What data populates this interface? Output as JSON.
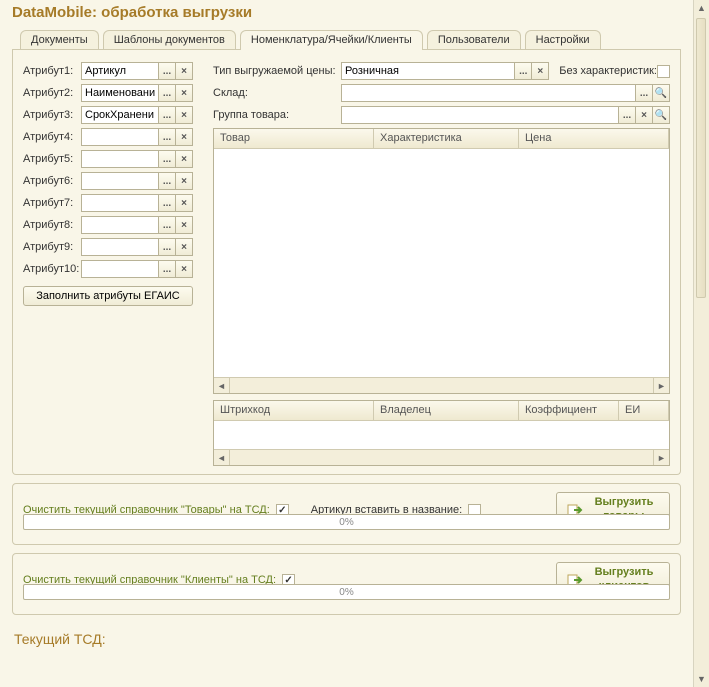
{
  "title": "DataMobile: обработка выгрузки",
  "tabs": [
    "Документы",
    "Шаблоны документов",
    "Номенклатура/Ячейки/Клиенты",
    "Пользователи",
    "Настройки"
  ],
  "active_tab": 2,
  "attributes": {
    "labels": [
      "Атрибут1:",
      "Атрибут2:",
      "Атрибут3:",
      "Атрибут4:",
      "Атрибут5:",
      "Атрибут6:",
      "Атрибут7:",
      "Атрибут8:",
      "Атрибут9:",
      "Атрибут10:"
    ],
    "values": [
      "Артикул",
      "Наименовани",
      "СрокХранени",
      "",
      "",
      "",
      "",
      "",
      "",
      ""
    ],
    "fill_btn": "Заполнить атрибуты ЕГАИС"
  },
  "top_fields": {
    "price_type_label": "Тип выгружаемой цены:",
    "price_type_value": "Розничная",
    "no_char_label": "Без характеристик:",
    "no_char_checked": false,
    "warehouse_label": "Склад:",
    "warehouse_value": "",
    "group_label": "Группа товара:",
    "group_value": ""
  },
  "grid1": {
    "cols": [
      "Товар",
      "Характеристика",
      "Цена"
    ]
  },
  "grid2": {
    "cols": [
      "Штрихкод",
      "Владелец",
      "Коэффициент",
      "ЕИ"
    ]
  },
  "export_goods": {
    "clear_label": "Очистить текущий справочник  \"Товары\" на ТСД:",
    "clear_checked": true,
    "insert_label": "Артикул вставить в название:",
    "insert_checked": false,
    "progress": "0%",
    "btn": "Выгрузить товары"
  },
  "export_clients": {
    "clear_label": "Очистить текущий справочник  \"Клиенты\" на ТСД:",
    "clear_checked": true,
    "progress": "0%",
    "btn": "Выгрузить клиентов"
  },
  "footer": "Текущий ТСД:"
}
